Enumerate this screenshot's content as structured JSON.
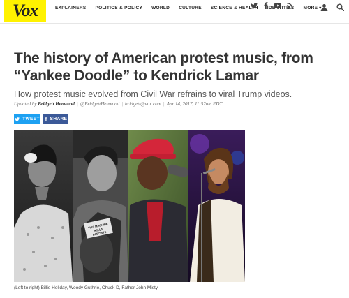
{
  "brand": {
    "logo_text": "Vox",
    "color": "#fff200"
  },
  "nav": {
    "items": [
      "EXPLAINERS",
      "POLITICS & POLICY",
      "WORLD",
      "CULTURE",
      "SCIENCE & HEALTH",
      "IDENTITIES",
      "MORE"
    ]
  },
  "social_icons": [
    "twitter-icon",
    "facebook-icon",
    "youtube-icon",
    "rss-icon"
  ],
  "article": {
    "headline": "The history of American protest music, from “Yankee Doodle” to Kendrick Lamar",
    "dek": "How protest music evolved from Civil War refrains to viral Trump videos.",
    "byline": {
      "prefix": "Updated by",
      "author": "Bridgett Henwood",
      "handle": "@BridgettHenwood",
      "email": "bridgett@vox.com",
      "date": "Apr 14, 2017, 11:52am EDT"
    },
    "share": {
      "tweet": "TWEET",
      "facebook": "SHARE"
    },
    "hero": {
      "guitar_text": "THIS MACHINE KILLS FASCISTS"
    },
    "caption": "(Left to right) Billie Holiday, Woody Guthrie, Chuck D, Father John Misty."
  },
  "colors": {
    "twitter": "#1da1f2",
    "facebook": "#3b5998"
  }
}
